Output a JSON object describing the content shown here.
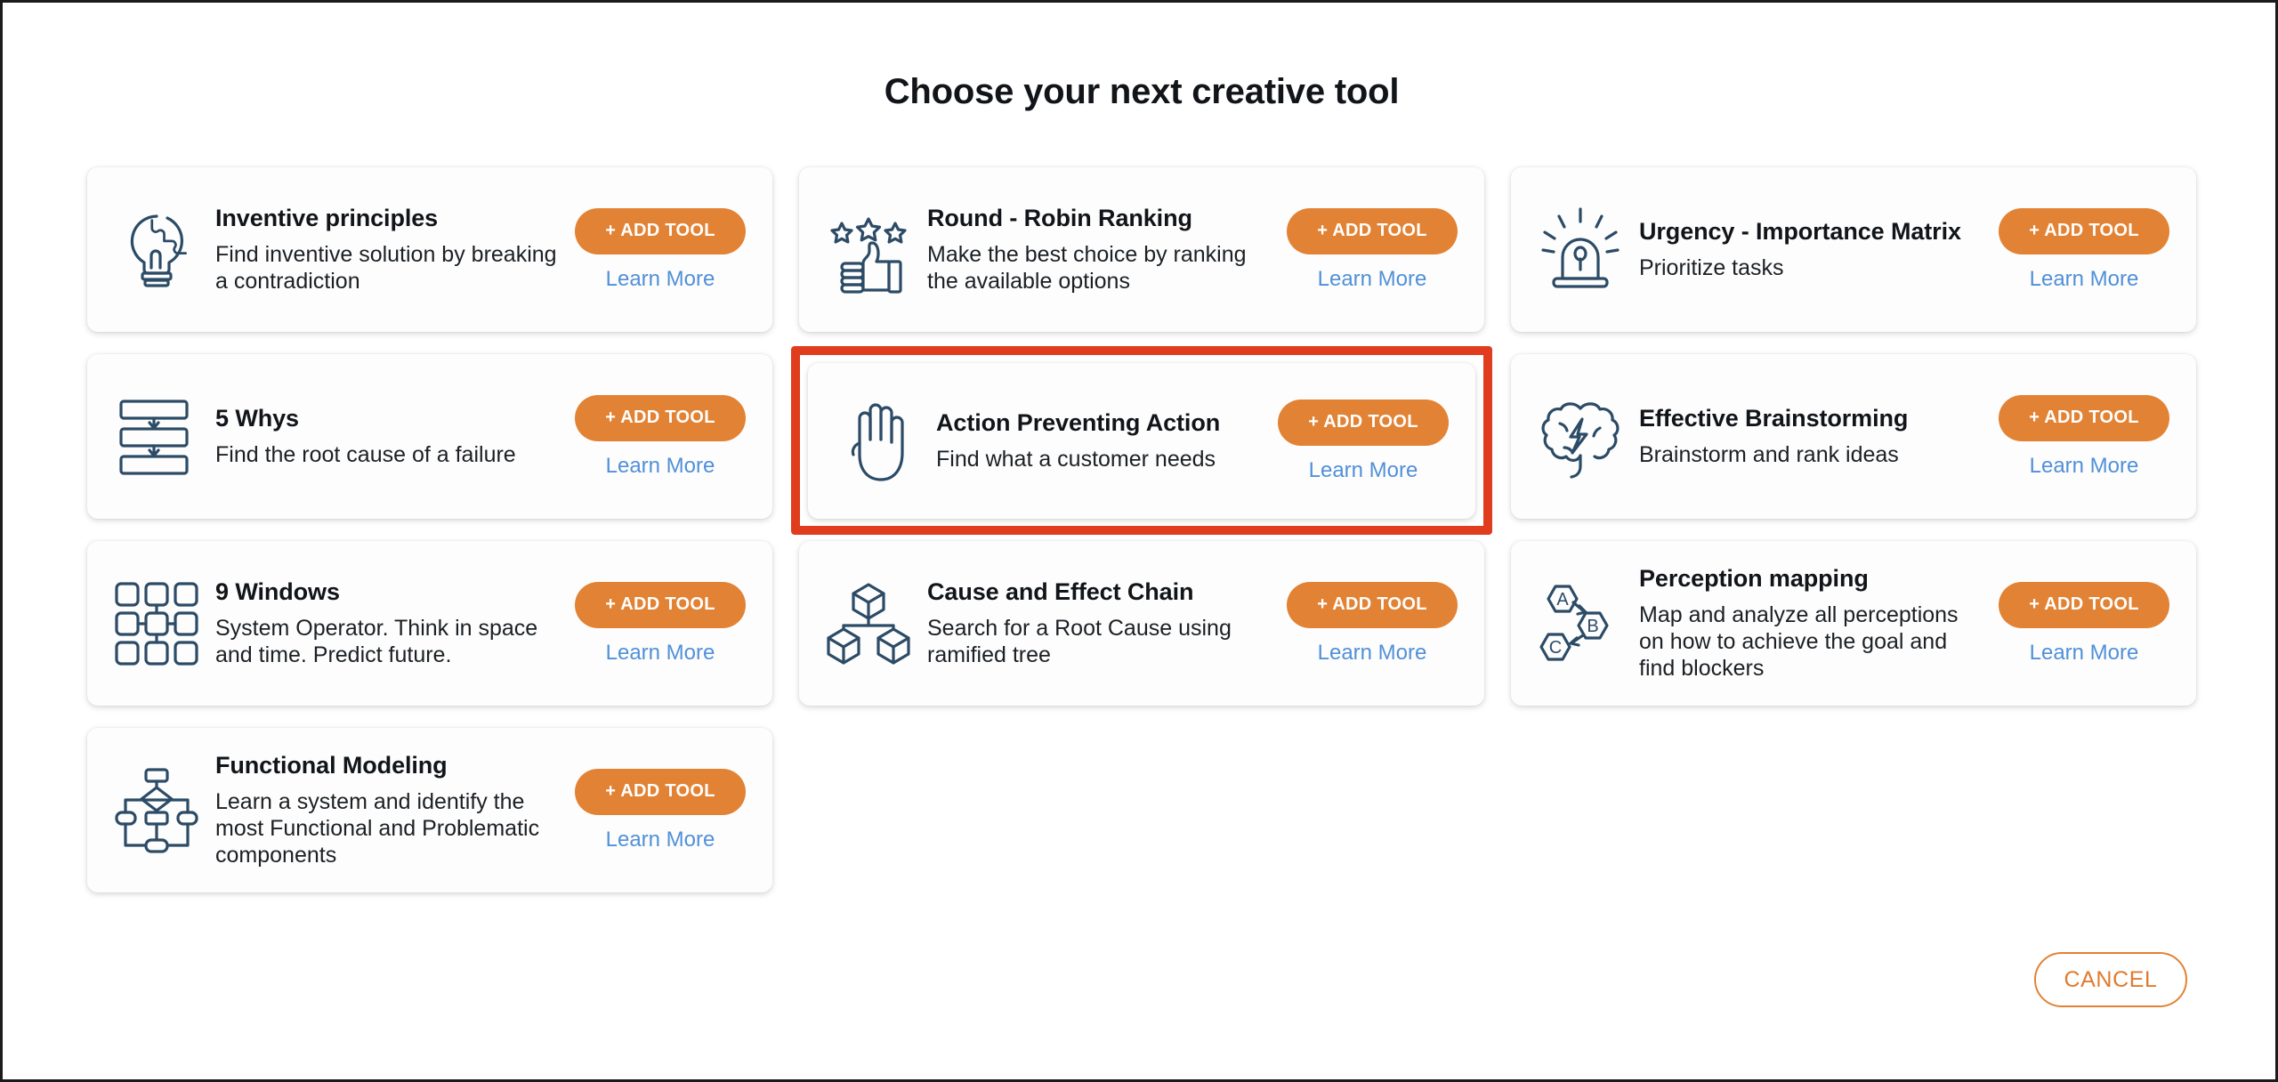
{
  "page": {
    "title": "Choose your next creative tool",
    "add_tool_label": "+ ADD TOOL",
    "learn_more_label": "Learn More",
    "cancel_label": "CANCEL",
    "accent_orange": "#E28234",
    "link_blue": "#5190D8",
    "icon_navy": "#2C4B66",
    "highlight_red": "#E03C1E"
  },
  "tools": [
    {
      "title": "Inventive principles",
      "description": "Find inventive solution by breaking a contradiction",
      "icon": "lightbulb-puzzle-icon",
      "add_tool_label": "+ ADD TOOL",
      "learn_more_label": "Learn More",
      "highlighted": false
    },
    {
      "title": "Round - Robin Ranking",
      "description": "Make the best choice by ranking the available options",
      "icon": "thumbs-up-stars-icon",
      "add_tool_label": "+ ADD TOOL",
      "learn_more_label": "Learn More",
      "highlighted": false
    },
    {
      "title": "Urgency - Importance Matrix",
      "description": "Prioritize tasks",
      "icon": "siren-beacon-icon",
      "add_tool_label": "+ ADD TOOL",
      "learn_more_label": "Learn More",
      "highlighted": false
    },
    {
      "title": "5 Whys",
      "description": "Find the root cause of a failure",
      "icon": "stacked-boxes-arrows-icon",
      "add_tool_label": "+ ADD TOOL",
      "learn_more_label": "Learn More",
      "highlighted": false
    },
    {
      "title": "Action Preventing Action",
      "description": "Find what a customer needs",
      "icon": "open-hand-icon",
      "add_tool_label": "+ ADD TOOL",
      "learn_more_label": "Learn More",
      "highlighted": true
    },
    {
      "title": "Effective Brainstorming",
      "description": "Brainstorm and rank ideas",
      "icon": "brain-lightning-icon",
      "add_tool_label": "+ ADD TOOL",
      "learn_more_label": "Learn More",
      "highlighted": false
    },
    {
      "title": "9 Windows",
      "description": "System Operator. Think in space and time. Predict future.",
      "icon": "nine-grid-icon",
      "add_tool_label": "+ ADD TOOL",
      "learn_more_label": "Learn More",
      "highlighted": false
    },
    {
      "title": "Cause and Effect Chain",
      "description": "Search for a Root Cause using ramified tree",
      "icon": "cube-tree-icon",
      "add_tool_label": "+ ADD TOOL",
      "learn_more_label": "Learn More",
      "highlighted": false
    },
    {
      "title": "Perception mapping",
      "description": "Map and analyze all perceptions on how to achieve the goal and find blockers",
      "icon": "hexagon-abc-icon",
      "add_tool_label": "+ ADD TOOL",
      "learn_more_label": "Learn More",
      "highlighted": false
    },
    {
      "title": "Functional Modeling",
      "description": "Learn a system and identify the most Functional and Problematic components",
      "icon": "flowchart-diamond-icon",
      "add_tool_label": "+ ADD TOOL",
      "learn_more_label": "Learn More",
      "highlighted": false
    }
  ]
}
